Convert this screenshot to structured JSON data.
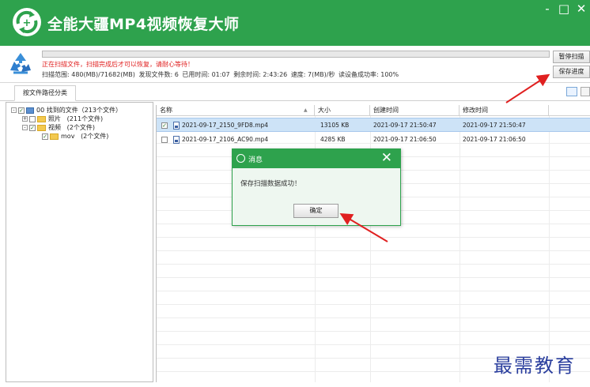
{
  "app": {
    "title": "全能大疆MP4视频恢复大师",
    "window_controls": {
      "minimize": "-",
      "maximize": "□",
      "close": "✕"
    },
    "accent_color": "#2ea24d"
  },
  "status": {
    "message": "正在扫描文件，扫描完成后才可以恢复，请耐心等待！",
    "scan_range": "扫描范围: 480(MB)/71682(MB)",
    "found_files": "发现文件数: 6",
    "elapsed": "已用时间: 01:07",
    "remaining": "剩余时间: 2:43:26",
    "speed": "速度: 7(MB)/秒",
    "read_rate": "读设备成功率: 100%",
    "pause_button": "暂停扫描",
    "save_progress_button": "保存进度"
  },
  "tabs": {
    "active": "按文件路径分类"
  },
  "tree": {
    "root": "00 找到的文件（213个文件）",
    "items": [
      {
        "label": "照片",
        "count": "(211个文件)"
      },
      {
        "label": "视频",
        "count": "(2个文件)"
      },
      {
        "label": "mov",
        "count": "(2个文件)"
      }
    ]
  },
  "table": {
    "columns": [
      "名称",
      "大小",
      "创建时间",
      "修改时间"
    ],
    "rows": [
      {
        "name": "2021-09-17_2150_9FD8.mp4",
        "size": "13105 KB",
        "created": "2021-09-17  21:50:47",
        "modified": "2021-09-17  21:50:47",
        "checked": true,
        "selected": true
      },
      {
        "name": "2021-09-17_2106_AC90.mp4",
        "size": "4285 KB",
        "created": "2021-09-17  21:06:50",
        "modified": "2021-09-17  21:06:50",
        "checked": false,
        "selected": false
      }
    ]
  },
  "dialog": {
    "title": "消息",
    "close": "✕",
    "message": "保存扫描数据成功！",
    "ok": "确定"
  },
  "watermark": "最需教育",
  "icons": [
    "app-logo-icon",
    "recycle-icon",
    "list-view-icon",
    "detail-view-icon",
    "folder-icon",
    "computer-icon",
    "video-file-icon",
    "info-icon"
  ],
  "annotation_color": "#e02020"
}
